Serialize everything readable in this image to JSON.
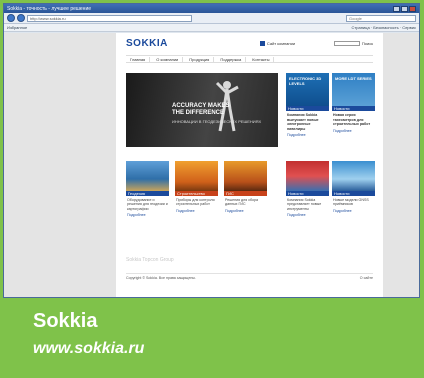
{
  "browser": {
    "title": "Sokkia - точность - лучшее решение",
    "address": "http://www.sokkia.ru",
    "search_placeholder": "Google",
    "toolbar_left": "Избранное",
    "toolbar_right": "Страница · Безопасность · Сервис"
  },
  "site": {
    "logo": "SOKKIA",
    "header_link": "Сайт компании",
    "search_label": "Поиск",
    "menu": [
      "Главная",
      "О компании",
      "Продукция",
      "Поддержка",
      "Контакты"
    ],
    "hero": {
      "headline": "ACCURACY MAKES THE DIFFERENCE",
      "subline": "ИННОВАЦИИ В ГЕОДЕЗИЧЕСКИХ РЕШЕНИЯХ"
    },
    "side": [
      {
        "image_caption": "ELECTRONIC 3D LEVELS",
        "bar": "Новости",
        "text": "Компания Sokkia выпускает новые электронные нивелиры",
        "link": "Подробнее"
      },
      {
        "image_caption": "MORE LDT SERIES",
        "bar": "Новости",
        "text": "Новая серия тахеометров для строительных работ",
        "link": "Подробнее"
      }
    ],
    "cards": [
      {
        "bar": "Геодезия",
        "text": "Оборудование и решения для геодезии и картографии",
        "link": "Подробнее"
      },
      {
        "bar": "Строительство",
        "text": "Приборы для контроля строительных работ",
        "link": "Подробнее"
      },
      {
        "bar": "ГИС",
        "text": "Решения для сбора данных ГИС",
        "link": "Подробнее"
      },
      {
        "bar": "Новости",
        "text": "Компания Sokkia представляет новые инструменты",
        "link": "Подробнее"
      },
      {
        "bar": "Новости",
        "text": "Новые модели GNSS приёмников",
        "link": "Подробнее"
      }
    ],
    "footer_title": "Sokkia Topcon Group",
    "footer_left": "Copyright © Sokkia. Все права защищены.",
    "footer_right": "О сайте"
  },
  "caption": {
    "brand": "Sokkia",
    "url": "www.sokkia.ru"
  },
  "colors": {
    "frame_green": "#7fc24a",
    "brand_blue": "#1b4a9c",
    "card_bars": [
      "#1b4a9c",
      "#c8421a",
      "#c8421a",
      "#1b4a9c",
      "#1b4a9c"
    ]
  }
}
